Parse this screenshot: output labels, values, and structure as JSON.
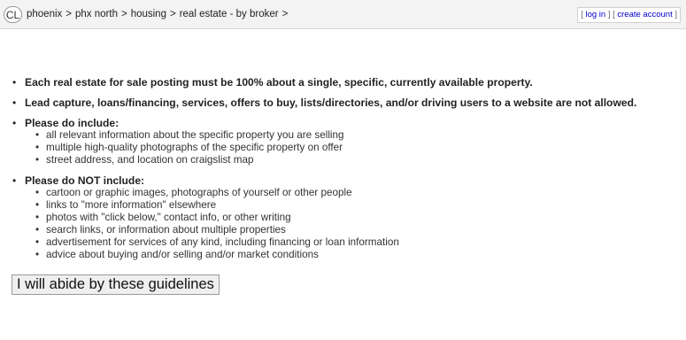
{
  "header": {
    "logo_text": "CL",
    "breadcrumb": [
      "phoenix",
      "phx north",
      "housing",
      "real estate - by broker"
    ],
    "separator": ">",
    "login": "log in",
    "create_account": "create account"
  },
  "guidelines": {
    "rule_1": "Each real estate for sale posting must be 100% about a single, specific, currently available property.",
    "rule_2": "Lead capture, loans/financing, services, offers to buy, lists/directories, and/or driving users to a website are not allowed.",
    "include_title": "Please do include:",
    "include_items": [
      "all relevant information about the specific property you are selling",
      "multiple high-quality photographs of the specific property on offer",
      "street address, and location on craigslist map"
    ],
    "exclude_title": "Please do NOT include:",
    "exclude_items": [
      "cartoon or graphic images, photographs of yourself or other people",
      "links to \"more information\" elsewhere",
      "photos with \"click below,\" contact info, or other writing",
      "search links, or information about multiple properties",
      "advertisement for services of any kind, including financing or loan information",
      "advice about buying and/or selling and/or market conditions"
    ]
  },
  "actions": {
    "abide_button": "I will abide by these guidelines"
  }
}
